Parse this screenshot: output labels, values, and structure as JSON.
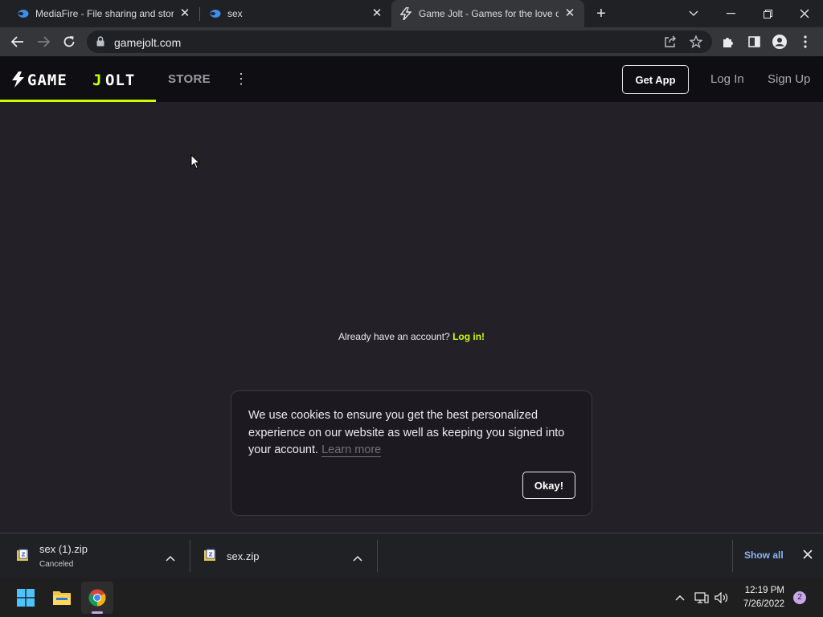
{
  "browser": {
    "tabs": [
      {
        "title": "MediaFire - File sharing and stora",
        "favicon": "mediafire-icon",
        "active": false
      },
      {
        "title": "sex",
        "favicon": "mediafire-icon",
        "active": false
      },
      {
        "title": "Game Jolt - Games for the love o",
        "favicon": "gamejolt-bolt-icon",
        "active": true
      }
    ],
    "url": "gamejolt.com"
  },
  "site": {
    "brand": "GAME JOLT",
    "accent_color": "#ccff00",
    "nav": {
      "store": "STORE"
    },
    "get_app": "Get App",
    "log_in": "Log In",
    "sign_up": "Sign Up"
  },
  "main": {
    "already_text": "Already have an account?",
    "login_link": "Log in!"
  },
  "cookie": {
    "text": "We use cookies to ensure you get the best personalized experience on our website as well as keeping you signed into your account.",
    "learn_more": "Learn more",
    "okay": "Okay!"
  },
  "downloads": {
    "items": [
      {
        "name": "sex (1).zip",
        "status": "Canceled"
      },
      {
        "name": "sex.zip",
        "status": ""
      }
    ],
    "show_all": "Show all"
  },
  "taskbar": {
    "time": "12:19 PM",
    "date": "7/26/2022",
    "notifications": "2"
  }
}
